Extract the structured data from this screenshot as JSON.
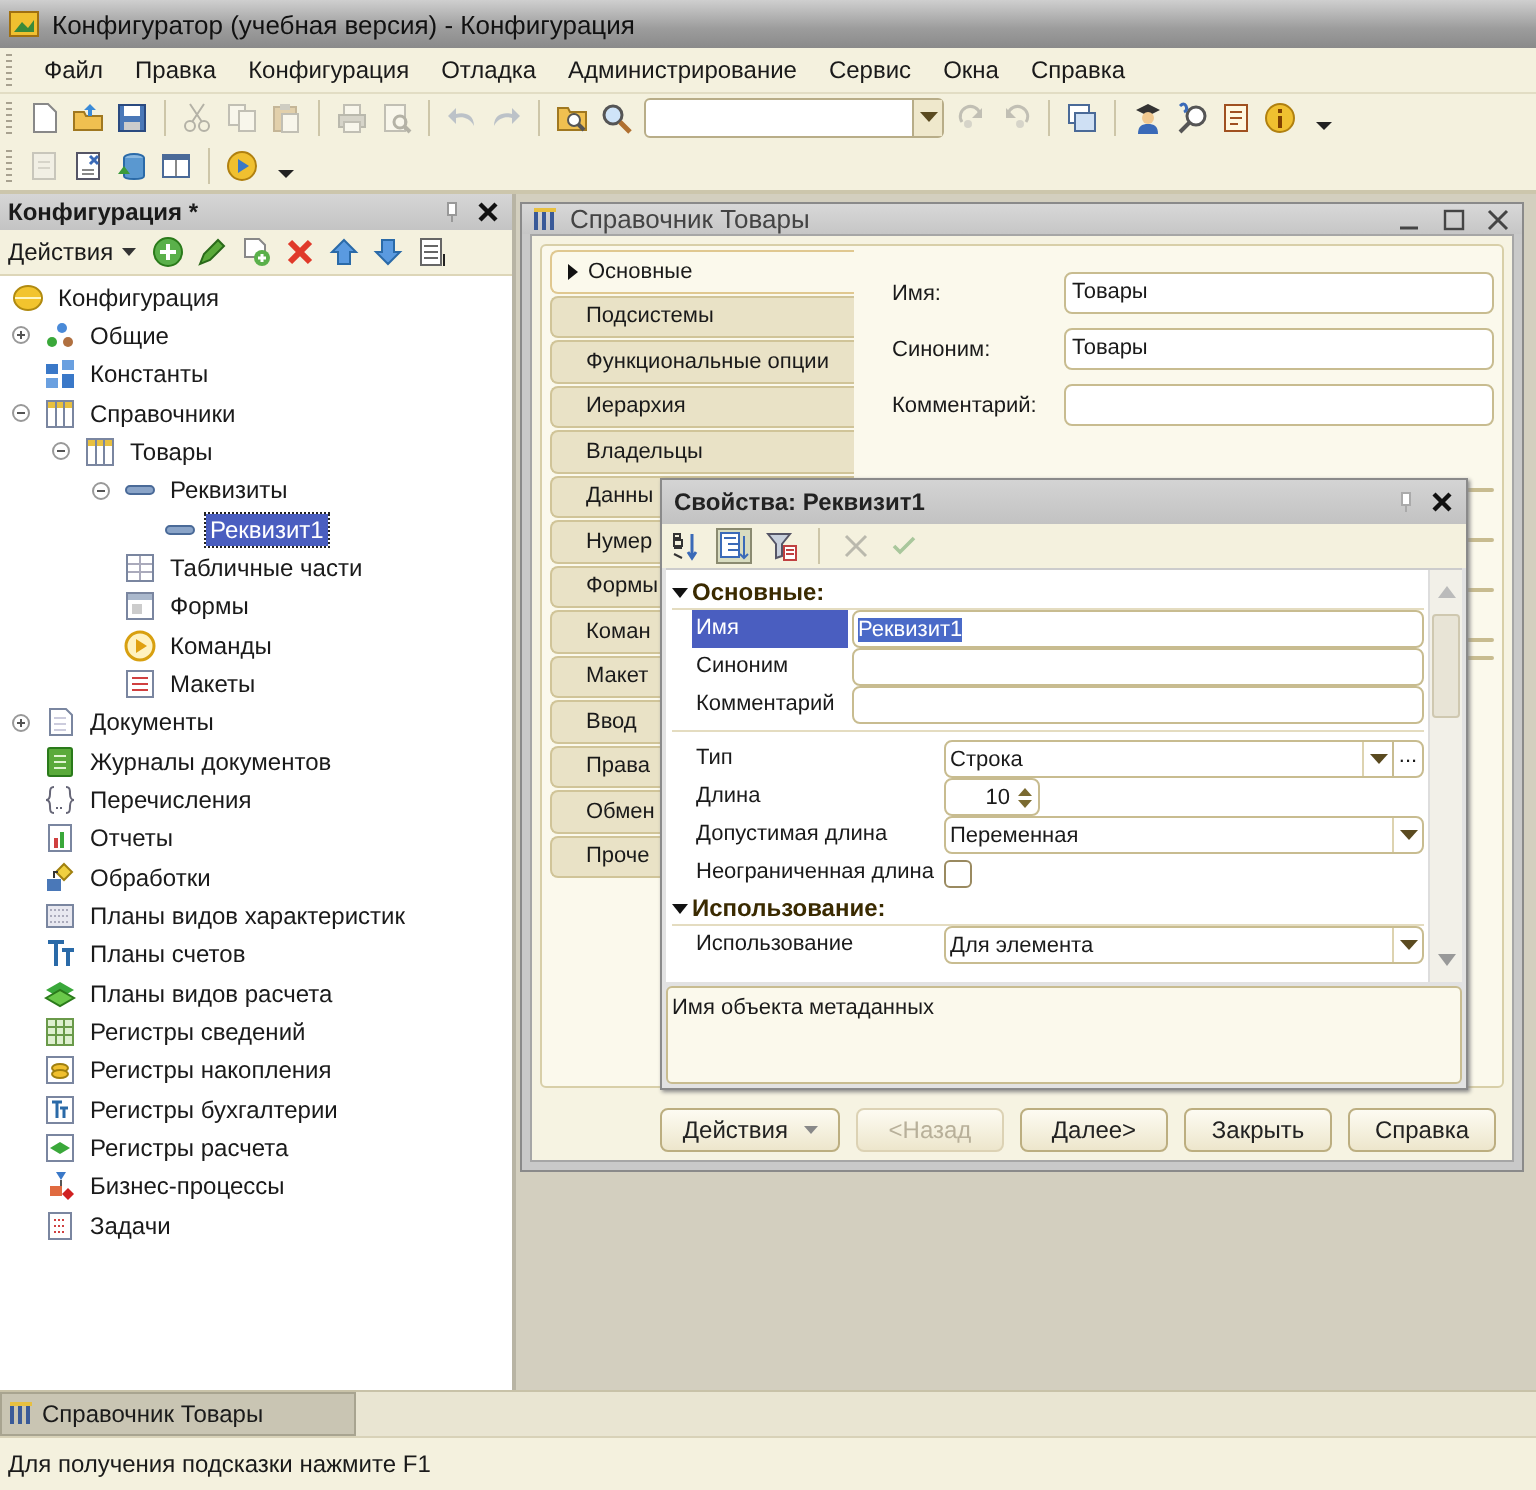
{
  "window": {
    "title": "Конфигуратор (учебная версия) - Конфигурация"
  },
  "menu": [
    "Файл",
    "Правка",
    "Конфигурация",
    "Отладка",
    "Администрирование",
    "Сервис",
    "Окна",
    "Справка"
  ],
  "toolbars": [
    [
      {
        "kind": "new",
        "disabled": false
      },
      {
        "kind": "open",
        "disabled": false
      },
      {
        "kind": "save",
        "disabled": false
      },
      {
        "kind": "sep"
      },
      {
        "kind": "cut",
        "disabled": true
      },
      {
        "kind": "copy",
        "disabled": true
      },
      {
        "kind": "paste",
        "disabled": true
      },
      {
        "kind": "sep"
      },
      {
        "kind": "print",
        "disabled": true
      },
      {
        "kind": "preview",
        "disabled": true
      },
      {
        "kind": "sep"
      },
      {
        "kind": "undo",
        "disabled": true
      },
      {
        "kind": "redo",
        "disabled": true
      },
      {
        "kind": "sep"
      },
      {
        "kind": "findtree",
        "disabled": false
      },
      {
        "kind": "search",
        "disabled": false
      },
      {
        "kind": "combo",
        "disabled": false
      },
      {
        "kind": "findnext",
        "disabled": true
      },
      {
        "kind": "findprev",
        "disabled": true
      },
      {
        "kind": "sep"
      },
      {
        "kind": "windows",
        "disabled": false
      },
      {
        "kind": "sep"
      },
      {
        "kind": "user",
        "disabled": false
      },
      {
        "kind": "helpsearch",
        "disabled": false
      },
      {
        "kind": "syntax",
        "disabled": false
      },
      {
        "kind": "info",
        "disabled": false
      },
      {
        "kind": "more",
        "disabled": false
      }
    ],
    [
      {
        "kind": "module",
        "disabled": true
      },
      {
        "kind": "compare",
        "disabled": false
      },
      {
        "kind": "dbupdate",
        "disabled": false
      },
      {
        "kind": "form",
        "disabled": false
      },
      {
        "kind": "sep"
      },
      {
        "kind": "run",
        "disabled": false
      },
      {
        "kind": "more",
        "disabled": false
      }
    ]
  ],
  "config_panel": {
    "title": "Конфигурация *",
    "actions_label": "Действия"
  },
  "tree": [
    {
      "label": "Конфигурация",
      "kind": "config",
      "selected": false,
      "children": [
        {
          "label": "Общие",
          "kind": "common",
          "selected": false,
          "expanded": false
        },
        {
          "label": "Константы",
          "kind": "constants",
          "selected": false
        },
        {
          "label": "Справочники",
          "kind": "catalog",
          "selected": false,
          "expanded": true,
          "children": [
            {
              "label": "Товары",
              "kind": "catalog",
              "selected": false,
              "expanded": true,
              "children": [
                {
                  "label": "Реквизиты",
                  "kind": "attribute",
                  "selected": false,
                  "expanded": true,
                  "children": [
                    {
                      "label": "Реквизит1",
                      "kind": "attribute",
                      "selected": true
                    }
                  ]
                },
                {
                  "label": "Табличные части",
                  "kind": "tabular",
                  "selected": false
                },
                {
                  "label": "Формы",
                  "kind": "forms",
                  "selected": false
                },
                {
                  "label": "Команды",
                  "kind": "commands",
                  "selected": false
                },
                {
                  "label": "Макеты",
                  "kind": "templates",
                  "selected": false
                }
              ]
            }
          ]
        },
        {
          "label": "Документы",
          "kind": "documents",
          "selected": false,
          "expanded": false
        },
        {
          "label": "Журналы документов",
          "kind": "journals",
          "selected": false
        },
        {
          "label": "Перечисления",
          "kind": "enums",
          "selected": false
        },
        {
          "label": "Отчеты",
          "kind": "reports",
          "selected": false
        },
        {
          "label": "Обработки",
          "kind": "processors",
          "selected": false
        },
        {
          "label": "Планы видов характеристик",
          "kind": "chars",
          "selected": false
        },
        {
          "label": "Планы счетов",
          "kind": "accounts",
          "selected": false
        },
        {
          "label": "Планы видов расчета",
          "kind": "calc",
          "selected": false
        },
        {
          "label": "Регистры сведений",
          "kind": "inforeg",
          "selected": false
        },
        {
          "label": "Регистры накопления",
          "kind": "accumreg",
          "selected": false
        },
        {
          "label": "Регистры бухгалтерии",
          "kind": "accountreg",
          "selected": false
        },
        {
          "label": "Регистры расчета",
          "kind": "calcreg",
          "selected": false
        },
        {
          "label": "Бизнес-процессы",
          "kind": "bizproc",
          "selected": false
        },
        {
          "label": "Задачи",
          "kind": "tasks",
          "selected": false
        }
      ]
    }
  ],
  "child_window": {
    "title": "Справочник Товары",
    "tabs": [
      {
        "label": "Основные",
        "selected": true
      },
      {
        "label": "Подсистемы",
        "selected": false
      },
      {
        "label": "Функциональные опции",
        "selected": false
      },
      {
        "label": "Иерархия",
        "selected": false
      },
      {
        "label": "Владельцы",
        "selected": false
      },
      {
        "label": "Данны",
        "selected": false
      },
      {
        "label": "Нумер",
        "selected": false
      },
      {
        "label": "Формы",
        "selected": false
      },
      {
        "label": "Коман",
        "selected": false
      },
      {
        "label": "Макет",
        "selected": false
      },
      {
        "label": "Ввод",
        "selected": false
      },
      {
        "label": "Права",
        "selected": false
      },
      {
        "label": "Обмен",
        "selected": false
      },
      {
        "label": "Проче",
        "selected": false
      }
    ],
    "fields": [
      {
        "label": "Имя:",
        "value": "Товары"
      },
      {
        "label": "Синоним:",
        "value": "Товары"
      },
      {
        "label": "Комментарий:"
      }
    ],
    "buttons": [
      {
        "label": "Действия",
        "kind": "menu",
        "disabled": false
      },
      {
        "label": "<Назад",
        "kind": "plain",
        "disabled": true
      },
      {
        "label": "Далее>",
        "kind": "plain",
        "disabled": false
      },
      {
        "label": "Закрыть",
        "kind": "plain",
        "disabled": false
      },
      {
        "label": "Справка",
        "kind": "plain",
        "disabled": false
      }
    ]
  },
  "properties": {
    "title": "Свойства: Реквизит1",
    "toolbar": [
      {
        "kind": "sort",
        "pressed": false,
        "disabled": false
      },
      {
        "kind": "categories",
        "pressed": true,
        "disabled": false
      },
      {
        "kind": "filter",
        "pressed": false,
        "disabled": false
      },
      {
        "kind": "delete",
        "pressed": false,
        "disabled": true
      },
      {
        "kind": "apply",
        "pressed": false,
        "disabled": true
      }
    ],
    "groups": [
      {
        "label": "Основные:",
        "expanded": true,
        "rows": [
          {
            "label": "Имя",
            "kind": "text",
            "value": "Реквизит1",
            "selected": true
          },
          {
            "label": "Синоним",
            "kind": "text",
            "selected": false
          },
          {
            "label": "Комментарий",
            "kind": "text",
            "selected": false
          },
          {
            "label": "Тип",
            "kind": "select",
            "value": "Строка",
            "choice_button": "...",
            "selected": false
          },
          {
            "label": "Длина",
            "kind": "spin",
            "value": "10",
            "selected": false
          },
          {
            "label": "Допустимая длина",
            "kind": "select",
            "value": "Переменная",
            "selected": false
          },
          {
            "label": "Неограниченная длина",
            "kind": "check",
            "checked": false,
            "selected": false
          }
        ]
      },
      {
        "label": "Использование:",
        "expanded": true,
        "rows": [
          {
            "label": "Использование",
            "kind": "select",
            "value": "Для элемента",
            "selected": false
          }
        ]
      }
    ],
    "description": "Имя объекта метаданных"
  },
  "window_tabs": [
    {
      "label": "Справочник Товары",
      "selected": true
    }
  ],
  "status_bar": "Для получения подсказки нажмите F1"
}
